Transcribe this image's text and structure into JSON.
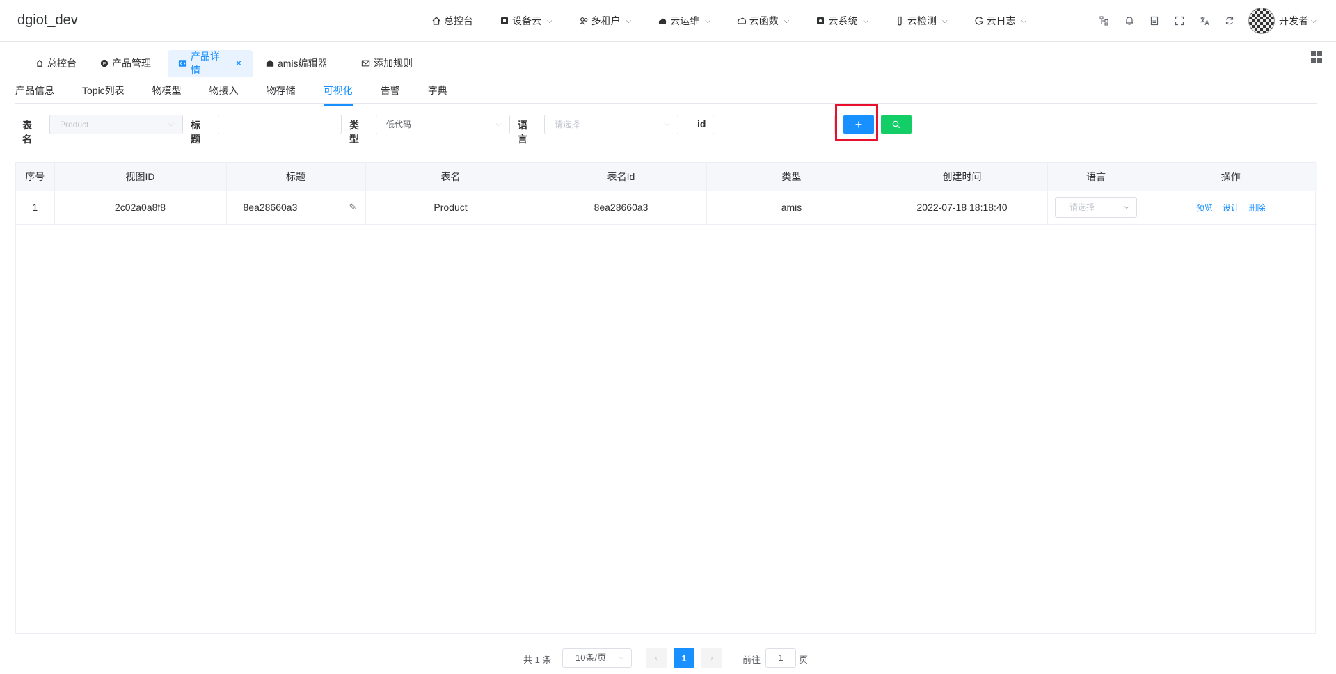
{
  "app": {
    "title": "dgiot_dev"
  },
  "topnav": [
    {
      "label": "总控台",
      "icon": "home-icon",
      "has_menu": false
    },
    {
      "label": "设备云",
      "icon": "device-icon",
      "has_menu": true
    },
    {
      "label": "多租户",
      "icon": "users-icon",
      "has_menu": true
    },
    {
      "label": "云运维",
      "icon": "cloud-ops-icon",
      "has_menu": true
    },
    {
      "label": "云函数",
      "icon": "cloud-icon",
      "has_menu": true
    },
    {
      "label": "云系统",
      "icon": "system-icon",
      "has_menu": true
    },
    {
      "label": "云检测",
      "icon": "test-tube-icon",
      "has_menu": true
    },
    {
      "label": "云日志",
      "icon": "log-icon",
      "has_menu": true
    }
  ],
  "user": {
    "name": "开发者"
  },
  "tags": [
    {
      "label": "总控台",
      "icon": "home-icon"
    },
    {
      "label": "产品管理",
      "icon": "product-icon"
    },
    {
      "label": "产品详情",
      "icon": "code-icon",
      "active": true
    },
    {
      "label": "amis编辑器",
      "icon": "editor-icon"
    },
    {
      "label": "添加规则",
      "icon": "mail-icon"
    }
  ],
  "subtabs": [
    "产品信息",
    "Topic列表",
    "物模型",
    "物接入",
    "物存储",
    "可视化",
    "告警",
    "字典"
  ],
  "active_subtab": "可视化",
  "filters": {
    "table_label": "表名",
    "table_value": "Product",
    "title_label": "标题",
    "title_value": "",
    "type_label": "类型",
    "type_value": "低代码",
    "lang_label": "语言",
    "lang_placeholder": "请选择",
    "id_label": "id",
    "id_value": "",
    "add_symbol": "+"
  },
  "table": {
    "headers": [
      "序号",
      "视图ID",
      "标题",
      "表名",
      "表名Id",
      "类型",
      "创建时间",
      "语言",
      "操作"
    ],
    "rows": [
      {
        "index": "1",
        "view_id": "2c02a0a8f8",
        "title": "8ea28660a3",
        "table_name": "Product",
        "table_id": "8ea28660a3",
        "type": "amis",
        "created": "2022-07-18 18:18:40",
        "lang_placeholder": "请选择",
        "actions": [
          "预览",
          "设计",
          "删除"
        ]
      }
    ]
  },
  "pager": {
    "total": "共 1 条",
    "page_size": "10条/页",
    "current_page": "1",
    "goto_label": "前往",
    "goto_value": "1",
    "page_suffix": "页"
  }
}
